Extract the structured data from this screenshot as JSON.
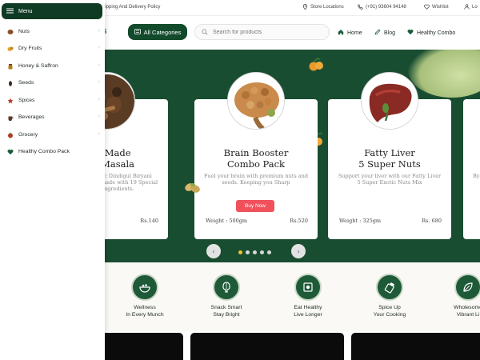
{
  "topbar": {
    "policy": "hipping And Delivery Policy",
    "store": "Store Locations",
    "phone": "(+91) 93604 94148",
    "wishlist": "Wishlist",
    "login": "Lo"
  },
  "header": {
    "logo_fragment": "s",
    "categories_label": "All Categories",
    "search_placeholder": "Search for products",
    "nav": [
      {
        "label": "Home",
        "icon": "home-icon"
      },
      {
        "label": "Blog",
        "icon": "pen-icon"
      },
      {
        "label": "Healthy Combo",
        "icon": "heart-icon"
      }
    ]
  },
  "menu": {
    "title": "Menu",
    "items": [
      {
        "label": "Nuts",
        "icon": "nut-icon",
        "color": "#8a4b2a"
      },
      {
        "label": "Dry Fruits",
        "icon": "dry-fruit-icon",
        "color": "#e6a52b"
      },
      {
        "label": "Honey & Saffron",
        "icon": "honey-icon",
        "color": "#b77a1f"
      },
      {
        "label": "Seeds",
        "icon": "seed-icon",
        "color": "#3b2a1f"
      },
      {
        "label": "Spices",
        "icon": "spice-icon",
        "color": "#b23a2a"
      },
      {
        "label": "Beverages",
        "icon": "beverage-icon",
        "color": "#5a3a2a"
      },
      {
        "label": "Grocery",
        "icon": "grocery-icon",
        "color": "#b23a2a"
      },
      {
        "label": "Healthy Combo Pack",
        "icon": "heart-icon",
        "color": "#1e5a38"
      }
    ]
  },
  "carousel": {
    "buy_label": "Buy Now",
    "cards": [
      {
        "title_l1": "ome Made",
        "title_l2": "yani Masala",
        "desc": "ic Dindigul Biryani nade with 19 Special ingredients.",
        "weight": "",
        "price": "Rs.140"
      },
      {
        "title_l1": "Brain Booster",
        "title_l2": "Combo Pack",
        "desc": "Fuel your brain with premium nuts and seeds. Keeping you Sharp",
        "weight": "Weight : 500gm",
        "price": "Rs.520"
      },
      {
        "title_l1": "Fatty Liver",
        "title_l2": "5 Super Nuts",
        "desc": "Support your liver with our Fatty Liver 5 Super Exotic Nuts Mix",
        "weight": "Weight : 325gm",
        "price": "Rs. 680"
      },
      {
        "title_l1": "",
        "title_l2": "",
        "desc": "By Pi",
        "weight": "",
        "price": ""
      }
    ],
    "prev_icon": "chevron-left-icon",
    "next_icon": "chevron-right-icon",
    "slide_count": 5,
    "active_slide": 1
  },
  "features": [
    {
      "l1": "Wellness",
      "l2": "In Every Munch",
      "icon": "bowl-icon"
    },
    {
      "l1": "Snack Smart",
      "l2": "Stay Bright",
      "icon": "brain-icon"
    },
    {
      "l1": "Eat Healthy",
      "l2": "Live Longer",
      "icon": "nutrition-icon"
    },
    {
      "l1": "Spice Up",
      "l2": "Your Cooking",
      "icon": "spice-jar-icon"
    },
    {
      "l1": "Wholesome",
      "l2": "Vibrant Li",
      "icon": "leaf-icon"
    }
  ],
  "colors": {
    "brand_green": "#194d31",
    "menu_green": "#0f3a23",
    "buy_red": "#f0515b",
    "dot_active": "#f2c230"
  }
}
